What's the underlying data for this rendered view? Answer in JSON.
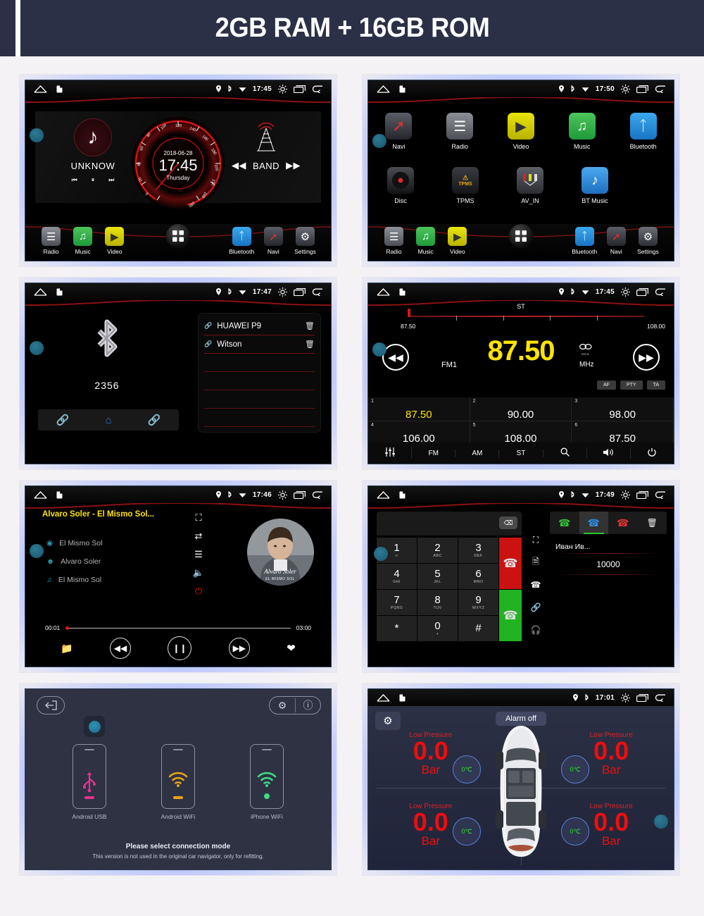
{
  "banner": {
    "title": "2GB RAM + 16GB ROM"
  },
  "shared": {
    "status_icons": [
      "location-icon",
      "bluetooth-icon",
      "wifi-icon"
    ],
    "nav_icons": [
      "home-icon",
      "lock-icon",
      "brightness-icon",
      "recents-icon",
      "back-icon"
    ]
  },
  "screens": {
    "home": {
      "name": "home-screen",
      "time": "17:45",
      "music": {
        "title": "UNKNOW",
        "prev": "⏮",
        "play": "⏸",
        "next": "⏭"
      },
      "gauge": {
        "date": "2018-06-28",
        "clock": "17:45",
        "weekday": "Thursday",
        "ticks": [
          "0",
          "20",
          "40",
          "60",
          "80",
          "100",
          "120",
          "140",
          "160",
          "180",
          "200",
          "220",
          "240",
          "260"
        ]
      },
      "radio": {
        "label": "BAND",
        "prev": "◀◀",
        "next": "▶▶"
      },
      "dock": [
        {
          "label": "Radio",
          "icon": "radio-icon"
        },
        {
          "label": "Music",
          "icon": "music-icon"
        },
        {
          "label": "Video",
          "icon": "video-icon"
        },
        {
          "label": "Bluetooth",
          "icon": "bluetooth-icon"
        },
        {
          "label": "Navi",
          "icon": "compass-icon"
        },
        {
          "label": "Settings",
          "icon": "gear-icon"
        }
      ],
      "apps_button": "all-apps-icon"
    },
    "apps": {
      "name": "app-drawer-screen",
      "time": "17:50",
      "row1": [
        {
          "label": "Navi",
          "icon": "compass-icon"
        },
        {
          "label": "Radio",
          "icon": "radio-icon"
        },
        {
          "label": "Video",
          "icon": "video-icon"
        },
        {
          "label": "Music",
          "icon": "music-icon"
        },
        {
          "label": "Bluetooth",
          "icon": "bluetooth-icon"
        }
      ],
      "row2": [
        {
          "label": "Disc",
          "icon": "disc-icon"
        },
        {
          "label": "TPMS",
          "icon": "tpms-icon"
        },
        {
          "label": "AV_IN",
          "icon": "av-in-icon"
        },
        {
          "label": "BT Music",
          "icon": "bt-music-icon"
        }
      ],
      "dock": [
        {
          "label": "Radio",
          "icon": "radio-icon"
        },
        {
          "label": "Music",
          "icon": "music-icon"
        },
        {
          "label": "Video",
          "icon": "video-icon"
        },
        {
          "label": "Bluetooth",
          "icon": "bluetooth-icon"
        },
        {
          "label": "Navi",
          "icon": "compass-icon"
        },
        {
          "label": "Settings",
          "icon": "gear-icon"
        }
      ]
    },
    "bluetooth": {
      "name": "bluetooth-screen",
      "time": "17:47",
      "pin": "2356",
      "actions": [
        "link-icon",
        "home-icon",
        "unlink-icon"
      ],
      "devices": [
        "HUAWEI P9",
        "Witson"
      ],
      "empty_rows": 4
    },
    "radio": {
      "name": "radio-screen",
      "time": "17:45",
      "stereo": "ST",
      "scale_min": "87.50",
      "scale_max": "108.00",
      "band": "FM1",
      "frequency": "87.50",
      "unit": "MHz",
      "rds": "RDS",
      "tags": [
        "AF",
        "PTY",
        "TA"
      ],
      "presets": [
        {
          "num": "1",
          "value": "87.50",
          "active": true
        },
        {
          "num": "2",
          "value": "90.00",
          "active": false
        },
        {
          "num": "3",
          "value": "98.00",
          "active": false
        },
        {
          "num": "4",
          "value": "106.00",
          "active": false
        },
        {
          "num": "5",
          "value": "108.00",
          "active": false
        },
        {
          "num": "6",
          "value": "87.50",
          "active": false
        }
      ],
      "bottom_bar": [
        {
          "label": "☷",
          "name": "equalizer-icon"
        },
        {
          "label": "FM",
          "name": "fm-button"
        },
        {
          "label": "AM",
          "name": "am-button"
        },
        {
          "label": "ST",
          "name": "st-button"
        },
        {
          "label": "⌕",
          "name": "search-icon"
        },
        {
          "label": "◂",
          "name": "volume-icon"
        },
        {
          "label": "⏻",
          "name": "power-icon"
        }
      ]
    },
    "music": {
      "name": "music-player-screen",
      "time": "17:46",
      "now_playing": "Alvaro Soler - El Mismo Sol...",
      "meta": [
        {
          "icon": "track-icon",
          "text": "El Mismo Sol"
        },
        {
          "icon": "artist-icon",
          "text": "Alvaro Soler"
        },
        {
          "icon": "album-icon",
          "text": "El Mismo Sol"
        }
      ],
      "side_icons": [
        "fullscreen-icon",
        "repeat-icon",
        "equalizer-icon",
        "volume-icon",
        "power-icon"
      ],
      "elapsed": "00:01",
      "duration": "03:00",
      "cover_artist": "Alvaro Soler",
      "cover_album": "EL MISMO SOL",
      "controls": [
        "folder-icon",
        "previous-icon",
        "pause-icon",
        "next-icon",
        "favorite-icon"
      ]
    },
    "phone": {
      "name": "phone-dialer-screen",
      "time": "17:49",
      "input_value": "",
      "keys": [
        {
          "d": "1",
          "s": "∞"
        },
        {
          "d": "2",
          "s": "ABC"
        },
        {
          "d": "3",
          "s": "DEF"
        },
        {
          "d": "4",
          "s": "GHI"
        },
        {
          "d": "5",
          "s": "JKL"
        },
        {
          "d": "6",
          "s": "MNO"
        },
        {
          "d": "7",
          "s": "PQRS"
        },
        {
          "d": "8",
          "s": "TUV"
        },
        {
          "d": "9",
          "s": "WXYZ"
        },
        {
          "d": "*",
          "s": ""
        },
        {
          "d": "0",
          "s": "+"
        },
        {
          "d": "#",
          "s": ""
        }
      ],
      "side_icons": [
        "fullscreen-icon",
        "contacts-icon",
        "call-log-icon",
        "link-icon",
        "headset-icon"
      ],
      "tabs": [
        "outgoing-calls-icon",
        "incoming-calls-icon",
        "missed-calls-icon",
        "delete-icon"
      ],
      "active_tab_index": 1,
      "contact_name": "Иван Ив...",
      "contact_number": "10000",
      "delete_key": "backspace-icon",
      "end_call": "end-call-icon",
      "call": "call-icon"
    },
    "connection": {
      "name": "connection-mode-screen",
      "back": "back-icon",
      "settings": "gear-icon",
      "help": "help-icon",
      "modes": [
        {
          "label": "Android USB",
          "icon": "usb-icon",
          "color": "#e8308f"
        },
        {
          "label": "Android WiFi",
          "icon": "wifi-icon",
          "color": "#e8a317"
        },
        {
          "label": "iPhone WiFi",
          "icon": "wifi-icon",
          "color": "#3ddc84"
        }
      ],
      "headline": "Please select connection mode",
      "subtext": "This version is not used in the original car navigator, only for refitting."
    },
    "tpms": {
      "name": "tpms-screen",
      "time": "17:01",
      "settings": "gear-icon",
      "alarm": "Alarm off",
      "wheels": [
        {
          "pos": "front-left",
          "status": "Low Pressure",
          "value": "0.0",
          "unit": "Bar",
          "temp": "0℃"
        },
        {
          "pos": "front-right",
          "status": "Low Pressure",
          "value": "0.0",
          "unit": "Bar",
          "temp": "0℃"
        },
        {
          "pos": "rear-left",
          "status": "Low Pressure",
          "value": "0.0",
          "unit": "Bar",
          "temp": "0℃"
        },
        {
          "pos": "rear-right",
          "status": "Low Pressure",
          "value": "0.0",
          "unit": "Bar",
          "temp": "0℃"
        }
      ]
    }
  },
  "colors": {
    "banner_bg": "#2b3047",
    "page_bg": "#f4f2f4",
    "frame_glow": "#4a62f5",
    "radio_yellow": "#ffe400",
    "alert_red": "#ef0d0d",
    "temp_green": "#2ee02e"
  }
}
